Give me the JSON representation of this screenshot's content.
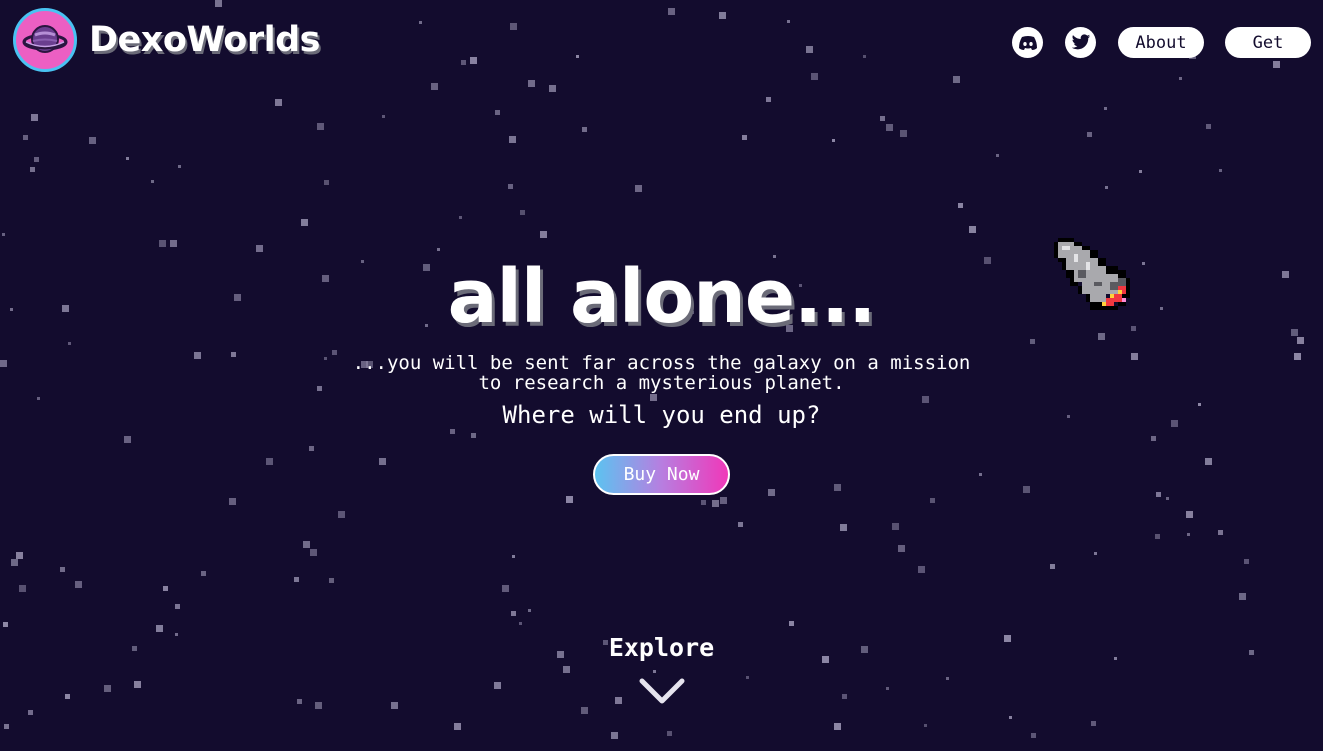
{
  "brand": {
    "name": "DexoWorlds",
    "logo_icon": "planet-icon",
    "badge_color": "#ec5fc3",
    "badge_ring_color": "#49c3f2"
  },
  "nav": {
    "discord_icon": "discord-icon",
    "twitter_icon": "twitter-icon",
    "about_label": "About",
    "get_label": "Get"
  },
  "hero": {
    "title": "all alone...",
    "subtitle_line1": "...you will be sent far across the galaxy on a mission",
    "subtitle_line2": "to research a mysterious planet.",
    "question": "Where will you end up?",
    "buy_label": "Buy Now",
    "rocket_icon": "rocket-icon"
  },
  "explore": {
    "label": "Explore",
    "icon": "chevron-down-icon"
  },
  "colors": {
    "background": "#130c2e",
    "star": "#8e88a6",
    "gradient_start": "#5cc3f0",
    "gradient_end": "#f038b9"
  }
}
